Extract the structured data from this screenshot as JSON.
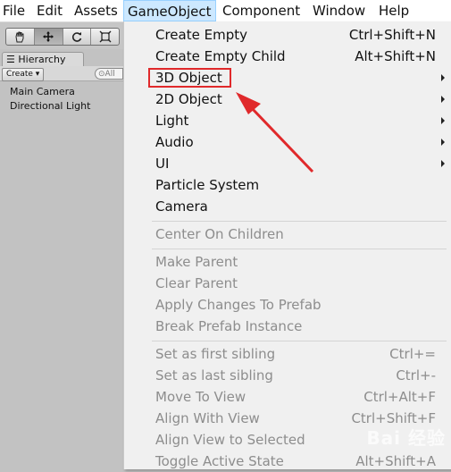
{
  "menubar": {
    "items": [
      "File",
      "Edit",
      "Assets",
      "GameObject",
      "Component",
      "Window",
      "Help"
    ],
    "active": "GameObject"
  },
  "toolbar": {
    "tools": [
      "hand-icon",
      "move-icon",
      "rotate-icon",
      "scale-icon"
    ]
  },
  "hierarchy": {
    "tab_label": "Hierarchy",
    "create_label": "Create ▾",
    "search_placeholder": "All",
    "items": [
      "Main Camera",
      "Directional Light"
    ]
  },
  "dropdown": {
    "group1": [
      {
        "label": "Create Empty",
        "shortcut": "Ctrl+Shift+N"
      },
      {
        "label": "Create Empty Child",
        "shortcut": "Alt+Shift+N"
      },
      {
        "label": "3D Object",
        "submenu": true
      },
      {
        "label": "2D Object",
        "submenu": true
      },
      {
        "label": "Light",
        "submenu": true
      },
      {
        "label": "Audio",
        "submenu": true
      },
      {
        "label": "UI",
        "submenu": true
      },
      {
        "label": "Particle System"
      },
      {
        "label": "Camera"
      }
    ],
    "group2": [
      {
        "label": "Center On Children"
      }
    ],
    "group3": [
      {
        "label": "Make Parent"
      },
      {
        "label": "Clear Parent"
      },
      {
        "label": "Apply Changes To Prefab"
      },
      {
        "label": "Break Prefab Instance"
      }
    ],
    "group4": [
      {
        "label": "Set as first sibling",
        "shortcut": "Ctrl+="
      },
      {
        "label": "Set as last sibling",
        "shortcut": "Ctrl+-"
      },
      {
        "label": "Move To View",
        "shortcut": "Ctrl+Alt+F"
      },
      {
        "label": "Align With View",
        "shortcut": "Ctrl+Shift+F"
      },
      {
        "label": "Align View to Selected"
      },
      {
        "label": "Toggle Active State",
        "shortcut": "Alt+Shift+A"
      }
    ]
  },
  "annotation": {
    "highlight_color": "#e0292b"
  },
  "watermark": "Bai 经验"
}
